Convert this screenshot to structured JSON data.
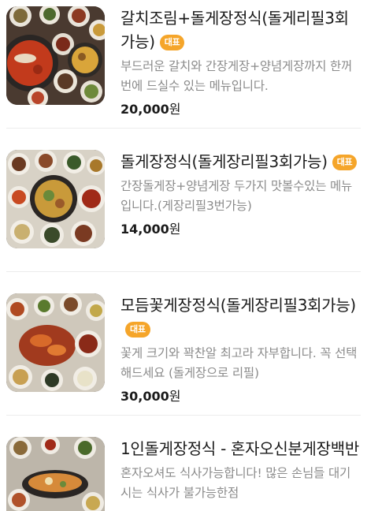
{
  "menu": {
    "items": [
      {
        "title": "갈치조림+돌게장정식(돌게리필3회가능)",
        "badge": "대표",
        "description": "부드러운 갈치와 간장게장+양념게장까지 한꺼번에 드실수 있는 메뉴입니다.",
        "price_number": "20,000",
        "price_unit": "원",
        "photo": "korean-table-set-with-braised-cutlassfish"
      },
      {
        "title": "돌게장정식(돌게장리필3회가능)",
        "badge": "대표",
        "description": "간장돌게장+양념게장 두가지 맛볼수있는 메뉴입니다.(게장리필3번가능)",
        "price_number": "14,000",
        "price_unit": "원",
        "photo": "korean-table-set-with-crab"
      },
      {
        "title": "모듬꽃게장정식(돌게장리필3회가능)",
        "badge": "대표",
        "description": "꽃게 크기와 꽉찬알 최고라 자부합니다. 꼭 선택해드세요 (돌게장으로 리필)",
        "price_number": "30,000",
        "price_unit": "원",
        "photo": "korean-table-set-with-flower-crab"
      },
      {
        "title": "1인돌게장정식 - 혼자오신분게장백반",
        "badge": "",
        "description": "혼자오셔도 식사가능합니다! 많은 손님들 대기시는 식사가 불가능한점",
        "price_number": "",
        "price_unit": "",
        "photo": "single-serving-crab-set"
      }
    ]
  },
  "colors": {
    "badge": "#f5a52a",
    "desc": "#8b8b8b",
    "title": "#1a1a1a",
    "divider": "#ececec"
  }
}
